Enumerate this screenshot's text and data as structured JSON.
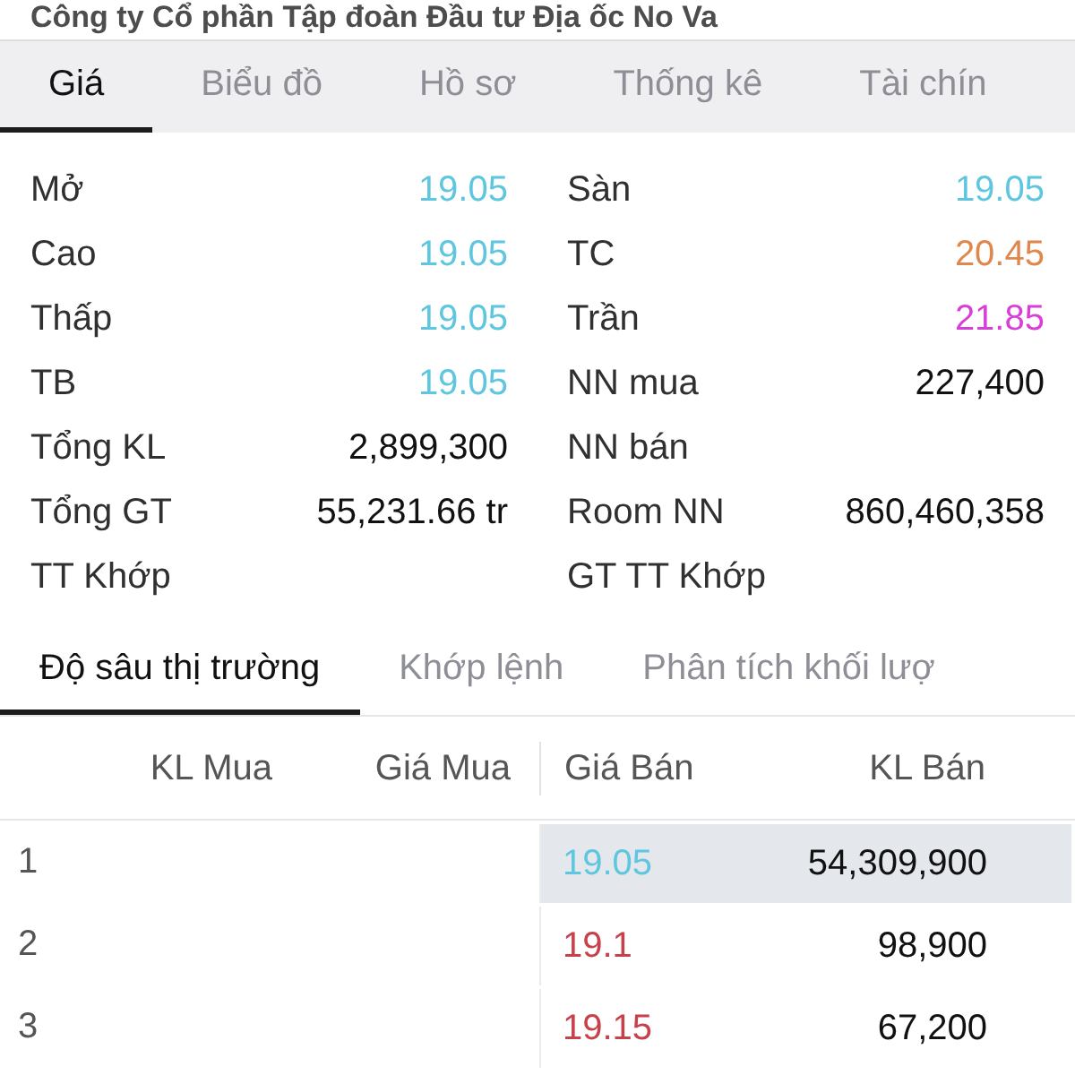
{
  "company_title": "Công ty Cổ phần Tập đoàn Đầu tư Địa ốc No Va",
  "tabs": [
    {
      "label": "Giá",
      "selected": true
    },
    {
      "label": "Biểu đồ",
      "selected": false
    },
    {
      "label": "Hồ sơ",
      "selected": false
    },
    {
      "label": "Thống kê",
      "selected": false
    },
    {
      "label": "Tài chín",
      "selected": false
    }
  ],
  "quote": {
    "left": [
      {
        "label": "Mở",
        "value": "19.05",
        "color": "#5ec6df"
      },
      {
        "label": "Cao",
        "value": "19.05",
        "color": "#5ec6df"
      },
      {
        "label": "Thấp",
        "value": "19.05",
        "color": "#5ec6df"
      },
      {
        "label": "TB",
        "value": "19.05",
        "color": "#5ec6df"
      },
      {
        "label": "Tổng KL",
        "value": "2,899,300"
      },
      {
        "label": "Tổng GT",
        "value": "55,231.66 tr"
      },
      {
        "label": "TT Khớp"
      }
    ],
    "right": [
      {
        "label": "Sàn",
        "value": "19.05",
        "color": "#5ec6df"
      },
      {
        "label": "TC",
        "value": "20.45",
        "color": "#e0874c"
      },
      {
        "label": "Trần",
        "value": "21.85",
        "color": "#d83fd8"
      },
      {
        "label": "NN mua",
        "value": "227,400"
      },
      {
        "label": "NN bán"
      },
      {
        "label": "Room NN",
        "value": "860,460,358"
      },
      {
        "label": "GT TT Khớp"
      }
    ]
  },
  "sub_tabs": [
    {
      "label": "Độ sâu thị trường",
      "selected": true
    },
    {
      "label": "Khớp lệnh",
      "selected": false
    },
    {
      "label": "Phân tích khối lượ",
      "selected": false
    }
  ],
  "order_book": {
    "columns": [
      "KL Mua",
      "Giá Mua",
      "Giá Bán",
      "KL Bán"
    ],
    "rows": [
      {
        "index": "1",
        "ask_price": "19.05",
        "ask_volume": "54,309,900",
        "color": "#5ec6df",
        "highlighted": true
      },
      {
        "index": "2",
        "ask_price": "19.1",
        "ask_volume": "98,900",
        "color": "#c7414b",
        "highlighted": false
      },
      {
        "index": "3",
        "ask_price": "19.15",
        "ask_volume": "67,200",
        "color": "#c7414b",
        "highlighted": false
      }
    ]
  }
}
